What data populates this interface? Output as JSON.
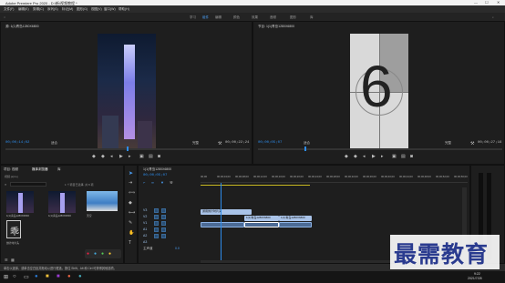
{
  "titlebar": {
    "title": "Adobe Premiere Pro 2020 - D:\\新\\视频教程 *",
    "min": "—",
    "max": "☐",
    "close": "✕"
  },
  "menu": [
    "文件(F)",
    "编辑(E)",
    "剪辑(C)",
    "序列(S)",
    "标记(M)",
    "图形(G)",
    "视图(V)",
    "窗口(W)",
    "帮助(H)"
  ],
  "workspaces": [
    "学习",
    "组件",
    "编辑",
    "颜色",
    "效果",
    "音频",
    "图形",
    "库"
  ],
  "active_workspace": "组件",
  "source_monitor": {
    "tab": "源: 1(1)青岛1280X6800",
    "timecode_in": "00;00;14;02",
    "fit": "适合",
    "full": "完整",
    "timecode_out": "00;00;22;24"
  },
  "program_monitor": {
    "tab": "节目: 1(1)青岛1280X6800",
    "timecode_in": "00;00;05;07",
    "fit": "适合",
    "full": "完整",
    "timecode_out": "00;00;27;16",
    "leader_number": "6"
  },
  "project_panel": {
    "tabs": [
      "项目: 视频",
      "媒体浏览器",
      "库"
    ],
    "active_tab": "媒体浏览器",
    "path": "视频.prproj",
    "search_placeholder": "",
    "items_label": "1 个项目已选择, 共 8 项",
    "thumbs": [
      {
        "label": "1(1)青岛1280X6800",
        "dur": "22;24"
      },
      {
        "label": "1(1)青岛1280X6800",
        "dur": "14;02"
      },
      {
        "label": "天空",
        "dur": "5;00"
      },
      {
        "label": "倒计时片头",
        "dur": "11;00"
      }
    ]
  },
  "timeline": {
    "tab": "1(1)青岛1280X6800",
    "timecode": "00;00;05;07",
    "ruler": [
      "00;00",
      "00;00;04;00",
      "00;00;08;00",
      "00;00;12;00",
      "00;00;16;00",
      "00;00;20;00",
      "00;00;24;00",
      "00;00;28;00",
      "00;00;32;00",
      "00;00;36;00",
      "00;00;40;00",
      "00;00;44;00",
      "00;00;48;00",
      "00;00;52;00",
      "00;00;56;00"
    ],
    "tracks": [
      "V3",
      "V2",
      "V1",
      "A1",
      "A2",
      "A3"
    ],
    "master": "主声道",
    "master_val": "0.0",
    "clips": [
      {
        "label": "通用倒计时片头",
        "track": "V2"
      },
      {
        "label": "1(1)青岛1280X6800",
        "track": "V1"
      },
      {
        "label": "1(1)青岛1280X6800",
        "track": "V1b"
      }
    ]
  },
  "status": {
    "text": "单击以选择，或单击空白处并拖动以进行框选。按住 Shift、Alt 和 Ctrl 可获得其他选项。"
  },
  "taskbar": {
    "time": "9:22",
    "date": "2021/7/28"
  },
  "watermark": "最需教育"
}
